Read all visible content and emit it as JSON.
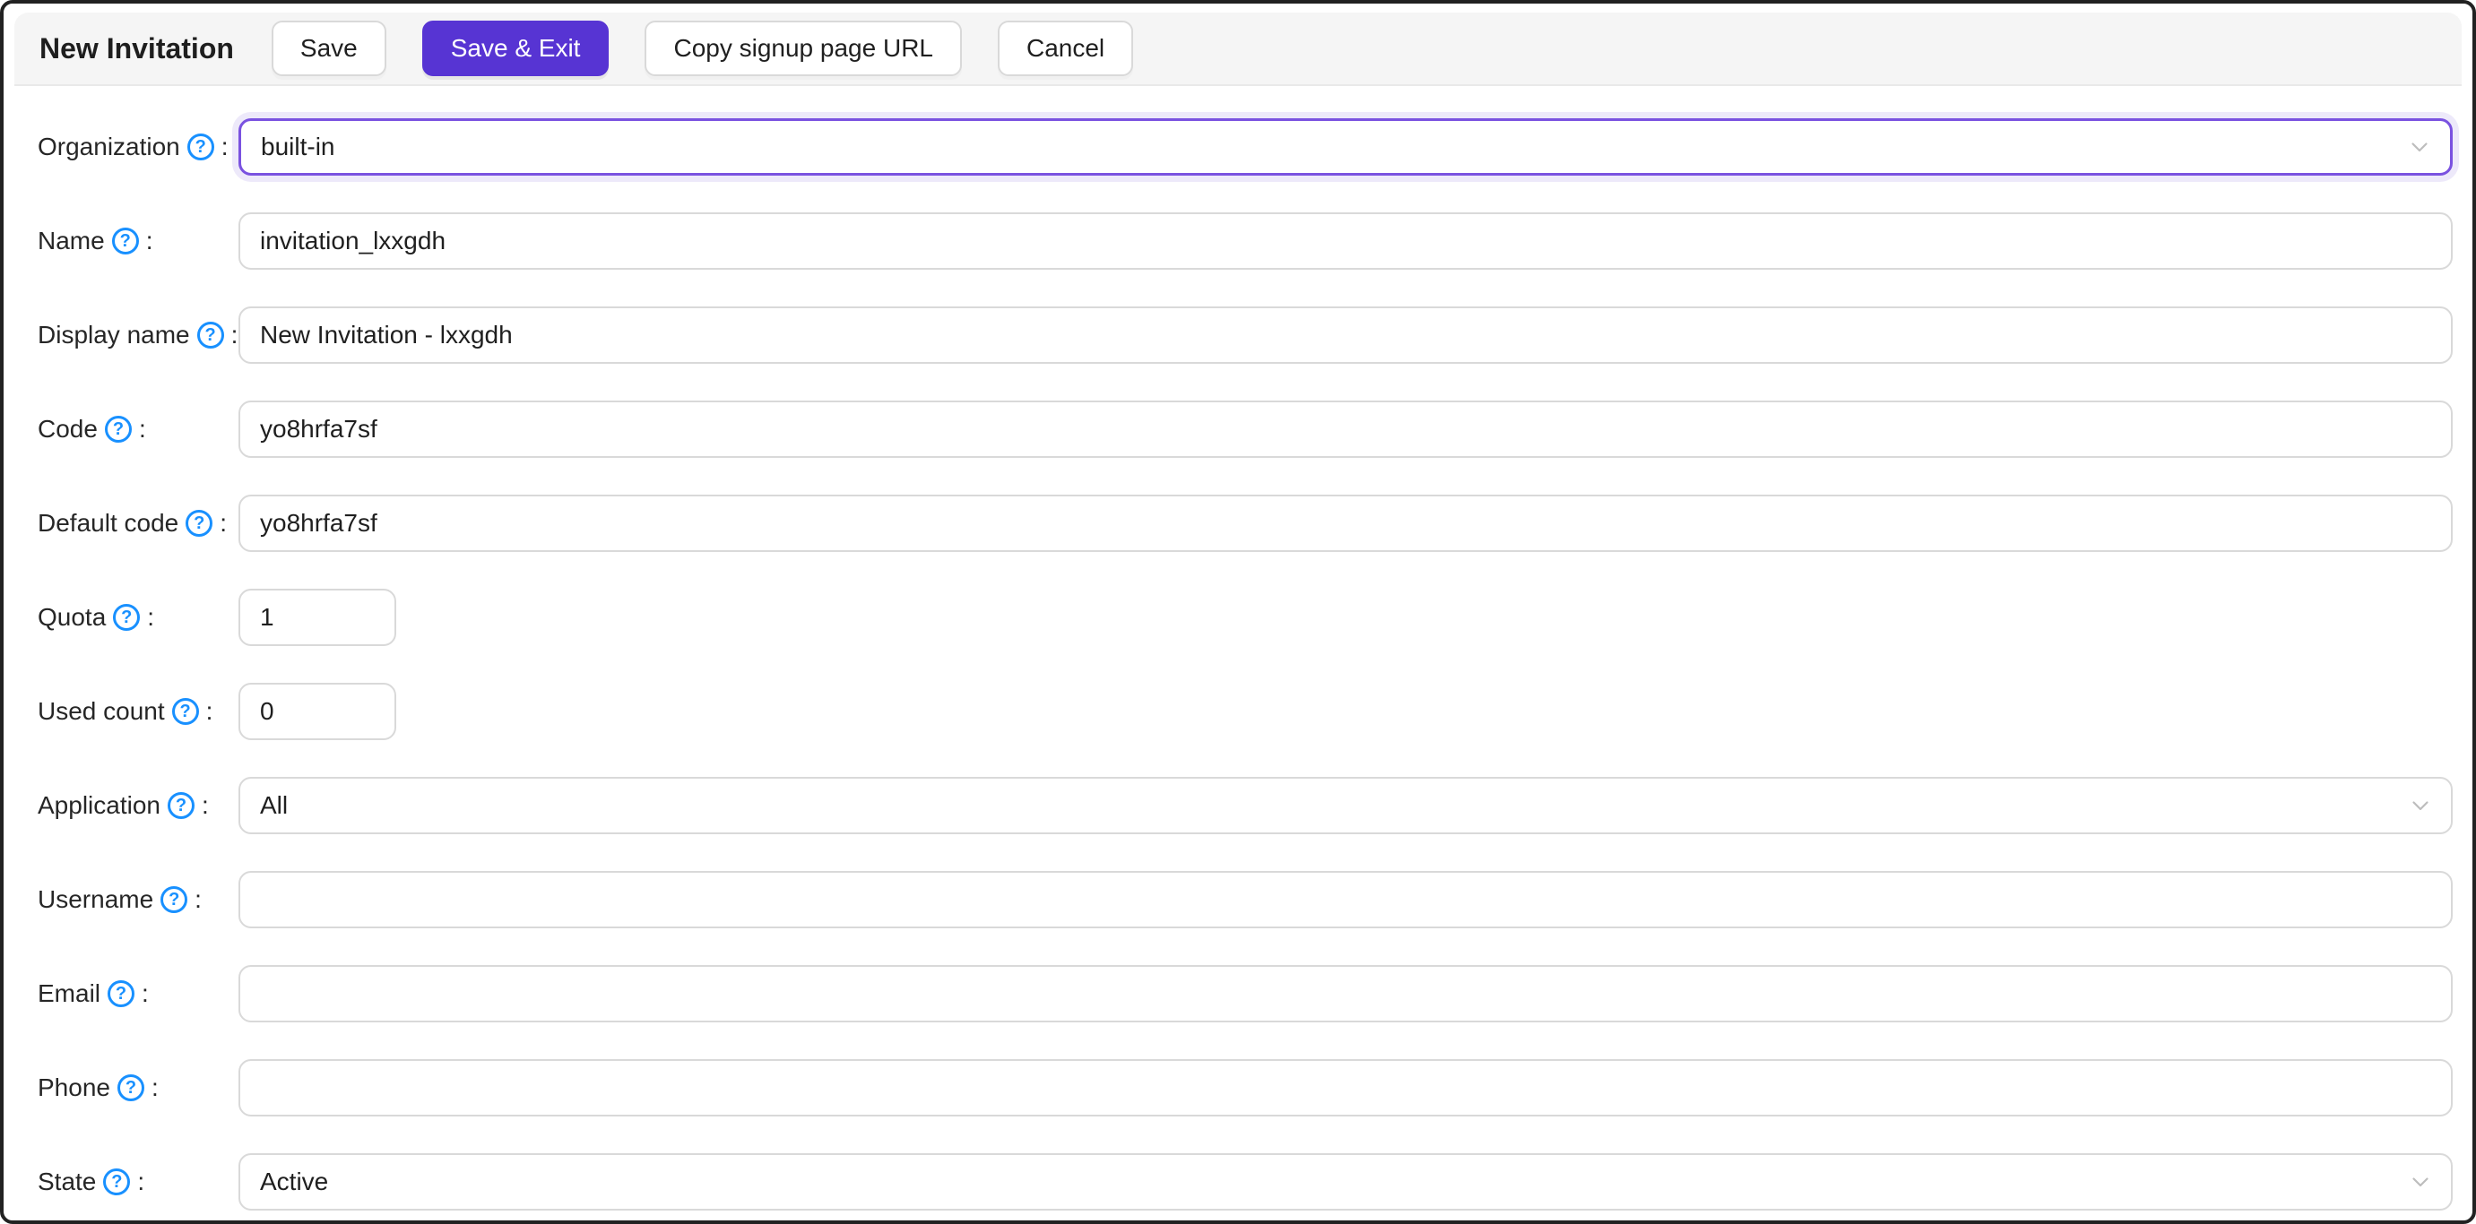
{
  "header": {
    "title": "New Invitation",
    "save_label": "Save",
    "save_exit_label": "Save & Exit",
    "copy_signup_url_label": "Copy signup page URL",
    "cancel_label": "Cancel"
  },
  "form": {
    "label_suffix": ":",
    "help_glyph": "?",
    "fields": [
      {
        "label": "Organization",
        "type": "select",
        "value": "built-in",
        "focused": true
      },
      {
        "label": "Name",
        "type": "text",
        "value": "invitation_lxxgdh"
      },
      {
        "label": "Display name",
        "type": "text",
        "value": "New Invitation - lxxgdh"
      },
      {
        "label": "Code",
        "type": "text",
        "value": "yo8hrfa7sf"
      },
      {
        "label": "Default code",
        "type": "text",
        "value": "yo8hrfa7sf"
      },
      {
        "label": "Quota",
        "type": "number",
        "value": "1"
      },
      {
        "label": "Used count",
        "type": "number",
        "value": "0"
      },
      {
        "label": "Application",
        "type": "select",
        "value": "All"
      },
      {
        "label": "Username",
        "type": "text",
        "value": ""
      },
      {
        "label": "Email",
        "type": "text",
        "value": ""
      },
      {
        "label": "Phone",
        "type": "text",
        "value": ""
      },
      {
        "label": "State",
        "type": "select",
        "value": "Active"
      }
    ]
  },
  "colors": {
    "primary": "#5734d3",
    "help_icon": "#1890ff",
    "focus_border": "#7a52e0"
  }
}
